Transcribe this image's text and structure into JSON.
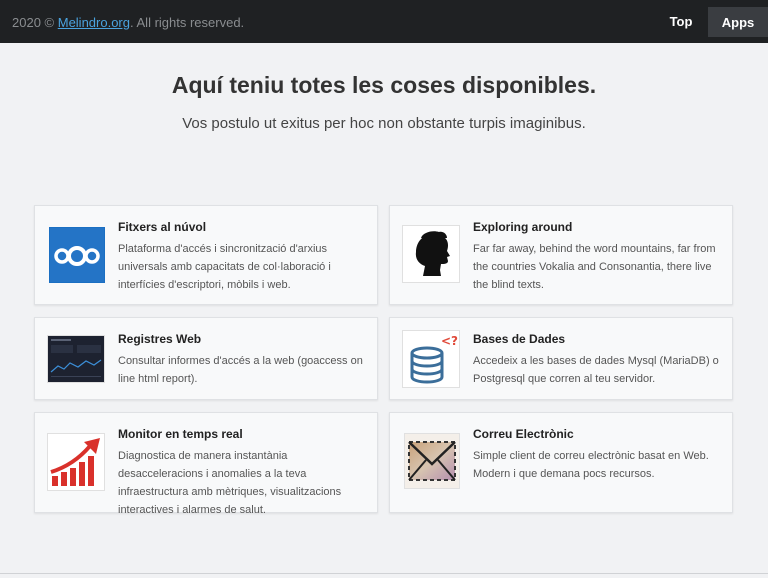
{
  "footer": {
    "copyright_prefix": "2020 © ",
    "site_link": "Melindro.org",
    "copyright_suffix": ". All rights reserved."
  },
  "nav": {
    "top_label": "Top",
    "apps_label": "Apps"
  },
  "hero": {
    "title": "Aquí teniu totes les coses disponibles.",
    "subtitle": "Vos postulo ut exitus per hoc non obstante turpis imaginibus."
  },
  "cards": [
    {
      "title": "Fitxers al núvol",
      "desc": "Plataforma d'accés i sincronització d'arxius universals amb capacitats de col·laboració i interfícies d'escriptori, mòbils i web.",
      "icon": "cloud-files-icon"
    },
    {
      "title": "Exploring around",
      "desc": "Far far away, behind the word mountains, far from the countries Vokalia and Consonantia, there live the blind texts.",
      "icon": "head-silhouette-icon"
    },
    {
      "title": "Registres Web",
      "desc": "Consultar informes d'accés a la web (goaccess on line html report).",
      "icon": "web-report-icon"
    },
    {
      "title": "Bases de Dades",
      "desc": "Accedeix a les bases de dades Mysql (MariaDB) o Postgresql que corren al teu servidor.",
      "icon": "database-icon"
    },
    {
      "title": "Monitor en temps real",
      "desc": "Diagnostica de manera instantània desacceleracions i anomalies a la teva infraestructura amb mètriques, visualitzacions interactives i alarmes de salut.",
      "icon": "growth-chart-icon"
    },
    {
      "title": "Correu Electrònic",
      "desc": "Simple client de correu electrònic basat en Web. Modern i que demana pocs recursos.",
      "icon": "envelope-icon"
    }
  ]
}
